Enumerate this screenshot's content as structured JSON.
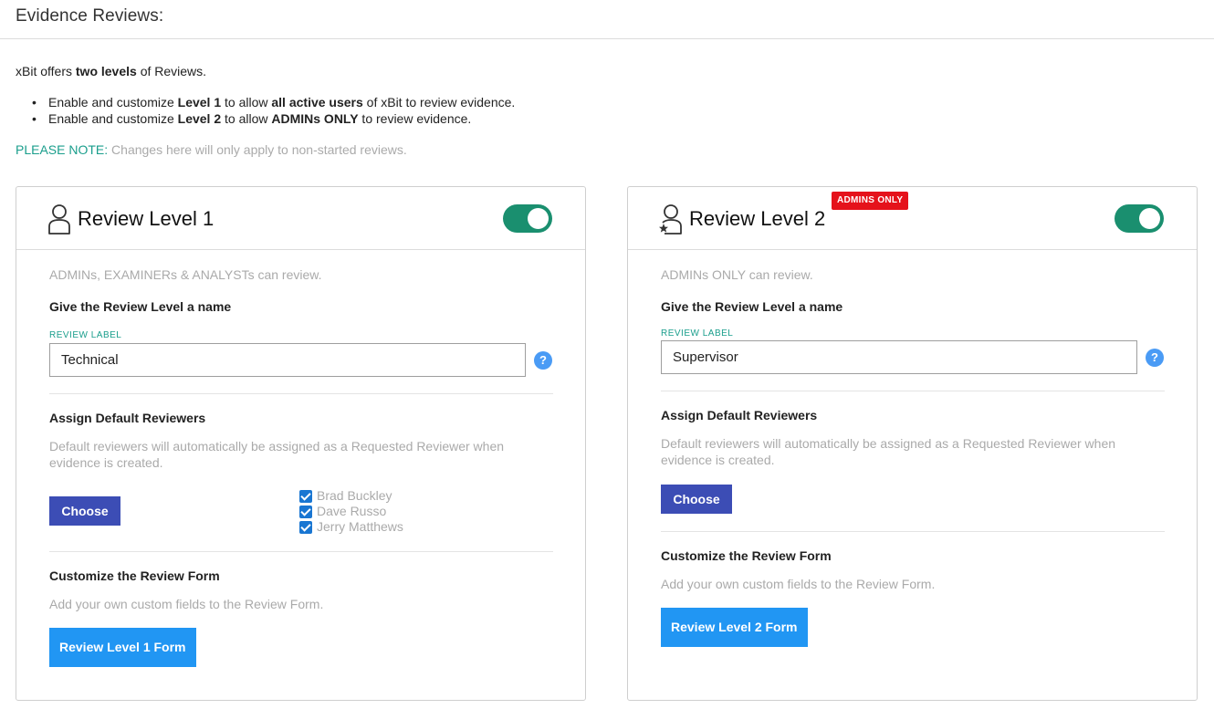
{
  "page": {
    "title": "Evidence Reviews:"
  },
  "intro": {
    "prefix": "xBit offers ",
    "bold": "two levels",
    "suffix": " of Reviews."
  },
  "bullets": [
    {
      "p1": "Enable and customize ",
      "b1": "Level 1",
      "p2": " to allow ",
      "b2": "all active users",
      "p3": " of xBit to review evidence."
    },
    {
      "p1": "Enable and customize ",
      "b1": "Level 2",
      "p2": " to allow ",
      "b2": "ADMINs ONLY",
      "p3": " to review evidence."
    }
  ],
  "note": {
    "label": "PLEASE NOTE:",
    "text": " Changes here will only apply to non-started reviews."
  },
  "level1": {
    "title": "Review Level 1",
    "enabled": true,
    "who": "ADMINs, EXAMINERs & ANALYSTs can review.",
    "name_heading": "Give the Review Level a name",
    "label_caption": "REVIEW LABEL",
    "label_value": "Technical",
    "help": "?",
    "assign_heading": "Assign Default Reviewers",
    "assign_desc": "Default reviewers will automatically be assigned as a Requested Reviewer when evidence is created.",
    "choose_label": "Choose",
    "reviewers": [
      "Brad Buckley",
      "Dave Russo",
      "Jerry Matthews"
    ],
    "form_heading": "Customize the Review Form",
    "form_desc": "Add your own custom fields to the Review Form.",
    "form_button": "Review Level 1 Form",
    "icon": "user-outline-icon"
  },
  "level2": {
    "title": "Review Level 2",
    "badge": "ADMINS ONLY",
    "enabled": true,
    "who": "ADMINs ONLY can review.",
    "name_heading": "Give the Review Level a name",
    "label_caption": "REVIEW LABEL",
    "label_value": "Supervisor",
    "help": "?",
    "assign_heading": "Assign Default Reviewers",
    "assign_desc": "Default reviewers will automatically be assigned as a Requested Reviewer when evidence is created.",
    "choose_label": "Choose",
    "form_heading": "Customize the Review Form",
    "form_desc": "Add your own custom fields to the Review Form.",
    "form_button": "Review Level 2 Form",
    "icon": "user-star-icon"
  },
  "colors": {
    "accent": "#1a9e8c",
    "toggle_on": "#1a8f6f",
    "primary_button": "#2196f3",
    "choose_button": "#3c4db5",
    "badge": "#e5121b"
  }
}
